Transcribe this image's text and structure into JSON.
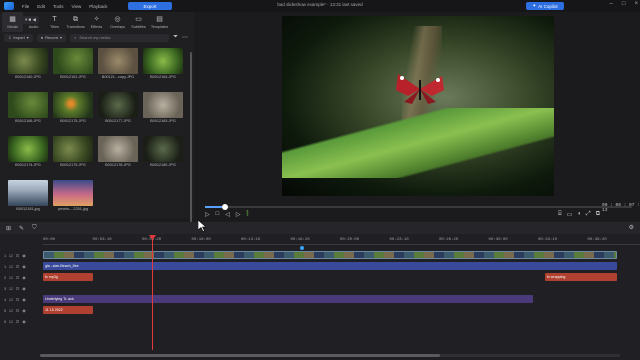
{
  "titlebar": {
    "menu": [
      "File",
      "Edit",
      "Tools",
      "View",
      "Playback"
    ],
    "export_label": "Export",
    "doc_title": "bad slideshow example* · 13:31 last saved",
    "ai_label": "AI Copilot"
  },
  "media_panel": {
    "tabs": [
      {
        "label": "Media",
        "icon": "media-icon"
      },
      {
        "label": "Audio",
        "icon": "music-icon"
      },
      {
        "label": "Titles",
        "icon": "title-icon"
      },
      {
        "label": "Transitions",
        "icon": "transition-icon"
      },
      {
        "label": "Effects",
        "icon": "effects-icon"
      },
      {
        "label": "Overlays",
        "icon": "overlay-icon"
      },
      {
        "label": "Subtitles",
        "icon": "subtitle-icon"
      },
      {
        "label": "Templates",
        "icon": "template-icon"
      }
    ],
    "import_label": "Import",
    "record_label": "Record",
    "search_placeholder": "Search my media",
    "items": [
      {
        "name": "B0012160.JPG",
        "style": "t-green1"
      },
      {
        "name": "B0012161.JPG",
        "style": "t-green2"
      },
      {
        "name": "B00121...copy.JPG",
        "style": "t-brown"
      },
      {
        "name": "B0012164.JPG",
        "style": "t-leaf"
      },
      {
        "name": "B0012166.JPG",
        "style": "t-green2"
      },
      {
        "name": "B0012175.JPG",
        "style": "t-orange"
      },
      {
        "name": "B0012177.JPG",
        "style": "t-dark"
      },
      {
        "name": "B0012183.JPG",
        "style": "t-gray"
      },
      {
        "name": "B0012174.JPG",
        "style": "t-leaf"
      },
      {
        "name": "B0012175.JPG",
        "style": "t-green1"
      },
      {
        "name": "B0012178.JPG",
        "style": "t-gray"
      },
      {
        "name": "B0012180.JPG",
        "style": "t-dark"
      },
      {
        "name": "B0012181.jpg",
        "style": "t-people"
      },
      {
        "name": "pexels-...2251.jpg",
        "style": "t-sunset"
      }
    ]
  },
  "preview": {
    "timecode": "00 : 00 : 07 : 13",
    "progress": 0.04,
    "controls": [
      "play-icon",
      "stop-icon",
      "prev-frame-icon",
      "next-frame-icon",
      "split-icon"
    ],
    "right_controls": [
      "snapshot-icon",
      "display-icon",
      "volume-icon",
      "fullscreen-icon",
      "undock-icon"
    ]
  },
  "timeline": {
    "ruler": [
      "00:00",
      "00:03:10",
      "00:06:20",
      "00:10:00",
      "00:13:10",
      "00:16:20",
      "00:20:00",
      "00:23:10",
      "00:26:20",
      "00:30:00",
      "00:33:10",
      "00:36:20"
    ],
    "zoom_label": "▾ ■ ◀",
    "tracks": [
      {
        "num": "1",
        "clips": [
          {
            "label": "",
            "class": "clip-video",
            "start": 0,
            "end": 574
          }
        ]
      },
      {
        "num": "1",
        "clips": [
          {
            "label": "gla...size-Beach_5ee",
            "class": "clip-audio-blue",
            "start": 0,
            "end": 574
          }
        ]
      },
      {
        "num": "2",
        "clips": [
          {
            "label": "fx mp3g",
            "class": "clip-red",
            "start": 0,
            "end": 50
          },
          {
            "label": "fx wrapping",
            "class": "clip-red",
            "start": 502,
            "end": 574
          }
        ]
      },
      {
        "num": "3",
        "clips": []
      },
      {
        "num": "4",
        "clips": [
          {
            "label": "Underlying Tr..ack",
            "class": "clip-audio-purple",
            "start": 0,
            "end": 490
          }
        ]
      },
      {
        "num": "5",
        "clips": [
          {
            "label": "11 15 2022",
            "class": "clip-red",
            "start": 0,
            "end": 50
          }
        ]
      },
      {
        "num": "6",
        "clips": []
      }
    ]
  }
}
